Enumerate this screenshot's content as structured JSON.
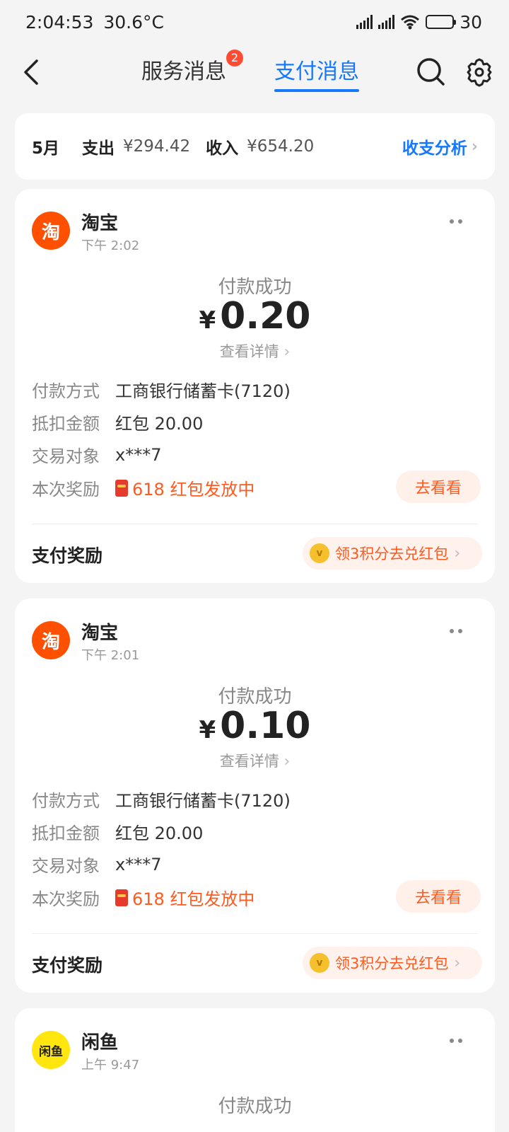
{
  "status_bar": {
    "time": "2:04:53",
    "temperature": "30.6°C",
    "battery": "30",
    "battery_level": 0.3
  },
  "header": {
    "tab_service": "服务消息",
    "tab_service_badge": "2",
    "tab_pay": "支付消息",
    "active_tab": "支付消息"
  },
  "summary": {
    "month": "5月",
    "expense_label": "支出",
    "expense_amount": "¥294.42",
    "income_label": "收入",
    "income_amount": "¥654.20",
    "analysis_label": "收支分析"
  },
  "transactions": [
    {
      "merchant": "淘宝",
      "logo_text": "淘",
      "time": "下午 2:02",
      "status": "付款成功",
      "currency": "¥",
      "amount": "0.20",
      "detail_link": "查看详情",
      "method_label": "付款方式",
      "method_value": "工商银行储蓄卡(7120)",
      "deduct_label": "抵扣金额",
      "deduct_value": "红包 20.00",
      "target_label": "交易对象",
      "target_value": "x***7",
      "reward_label": "本次奖励",
      "reward_value": "618 红包发放中",
      "go_button": "去看看",
      "pay_reward_label": "支付奖励",
      "points_text": "领3积分去兑红包"
    },
    {
      "merchant": "淘宝",
      "logo_text": "淘",
      "time": "下午 2:01",
      "status": "付款成功",
      "currency": "¥",
      "amount": "0.10",
      "detail_link": "查看详情",
      "method_label": "付款方式",
      "method_value": "工商银行储蓄卡(7120)",
      "deduct_label": "抵扣金额",
      "deduct_value": "红包 20.00",
      "target_label": "交易对象",
      "target_value": "x***7",
      "reward_label": "本次奖励",
      "reward_value": "618 红包发放中",
      "go_button": "去看看",
      "pay_reward_label": "支付奖励",
      "points_text": "领3积分去兑红包"
    },
    {
      "merchant": "闲鱼",
      "logo_text": "闲鱼",
      "time": "上午 9:47",
      "status": "付款成功"
    }
  ],
  "colors": {
    "accent_blue": "#1677ff",
    "taobao_orange": "#ff5000",
    "xianyu_yellow": "#ffe60f",
    "reward_orange": "#ff5a1f",
    "badge_red": "#ff4b33"
  },
  "icons": {
    "back": "chevron-left-icon",
    "search": "search-icon",
    "settings": "gear-icon",
    "more": "more-dots-icon",
    "chevron": "chevron-right-icon",
    "redpack": "red-packet-icon",
    "coin": "coin-icon"
  }
}
